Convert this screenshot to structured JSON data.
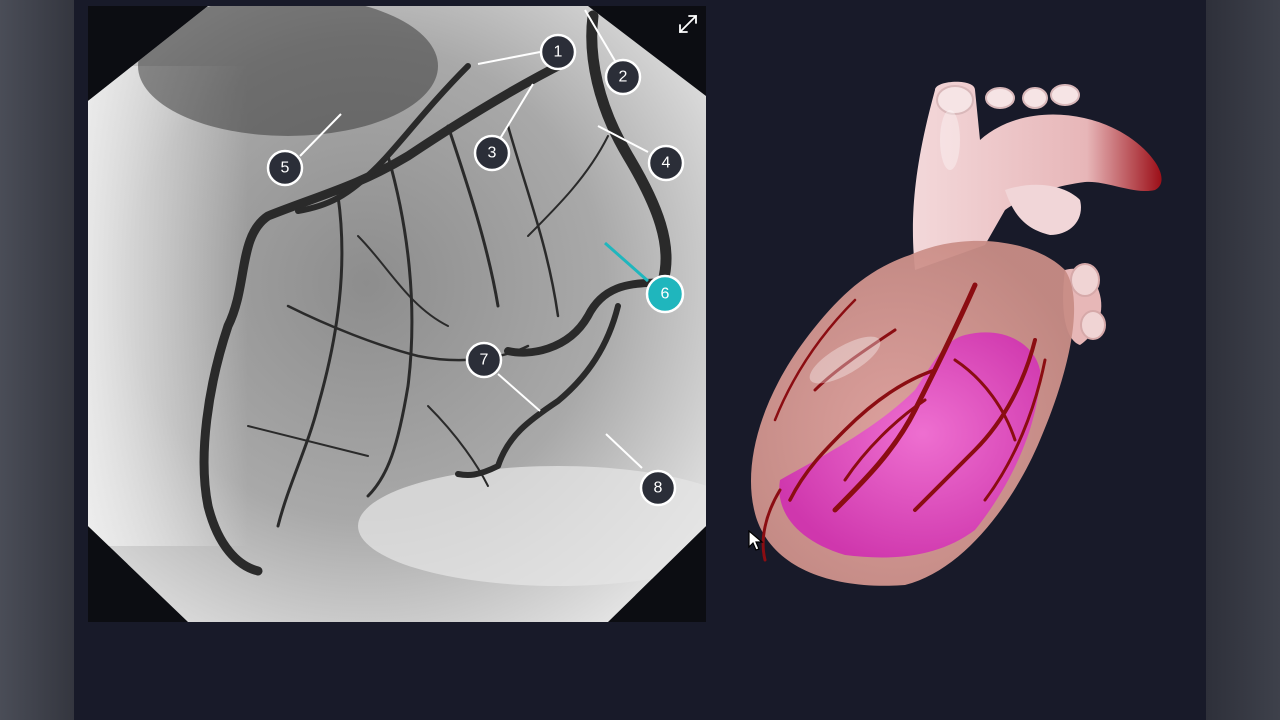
{
  "viewer": {
    "expand_icon": "expand-arrows-icon",
    "markers": [
      {
        "label": "1",
        "active": false
      },
      {
        "label": "2",
        "active": false
      },
      {
        "label": "3",
        "active": false
      },
      {
        "label": "4",
        "active": false
      },
      {
        "label": "5",
        "active": false
      },
      {
        "label": "6",
        "active": true
      },
      {
        "label": "7",
        "active": false
      },
      {
        "label": "8",
        "active": false
      }
    ]
  },
  "colors": {
    "stage_bg": "#181a29",
    "marker_fill": "#2b2e38",
    "marker_active": "#1fb6bd",
    "vessel": "#2a2a2a",
    "heart_vessel": "#8b0d12",
    "heart_ventricle": "#d640b4"
  }
}
